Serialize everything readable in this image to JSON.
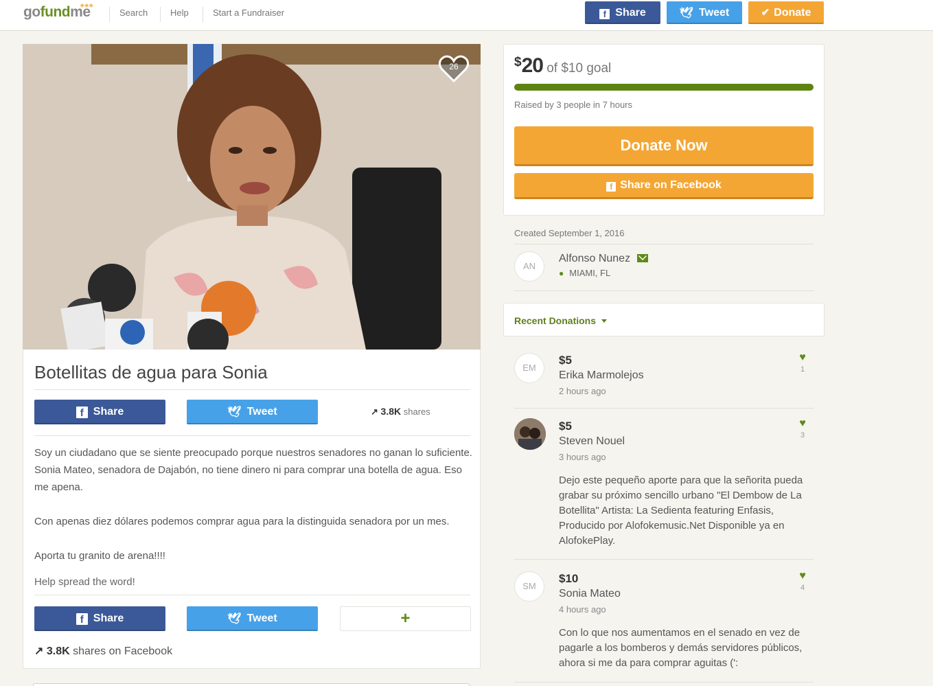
{
  "header": {
    "logo": {
      "go": "go",
      "fund": "fund",
      "me": "me"
    },
    "nav": [
      "Search",
      "Help",
      "Start a Fundraiser"
    ],
    "share_label": "Share",
    "tweet_label": "Tweet",
    "donate_label": "Donate",
    "colors": {
      "share": "#3b5998",
      "tweet": "#46a1e8",
      "donate": "#f4a634"
    }
  },
  "campaign": {
    "heart_count": "26",
    "title": "Botellitas de agua para Sonia",
    "share_label": "Share",
    "tweet_label": "Tweet",
    "shares_count": "3.8K",
    "shares_word": "shares",
    "story": [
      "Soy un ciudadano que se siente preocupado porque nuestros senadores no ganan lo suficiente.  Sonia Mateo, senadora de Dajabón, no tiene dinero ni para comprar una botella de agua.  Eso me apena.",
      "Con apenas diez dólares podemos comprar agua para la distinguida senadora por un mes.",
      "Aporta tu granito de arena!!!!"
    ],
    "help_spread": "Help spread the word!",
    "plus_label": "+",
    "shares_fb_count": "3.8K",
    "shares_fb_text": "shares on Facebook"
  },
  "goal": {
    "dollar": "$",
    "raised": "20",
    "goal_text": "of $10 goal",
    "progress_fraction": 1.0,
    "raised_by": "Raised by 3 people in 7 hours",
    "donate_now": "Donate Now",
    "share_facebook": "Share on Facebook",
    "accent": "#f4a634",
    "bar_color": "#5e8313"
  },
  "organizer": {
    "created": "Created September 1, 2016",
    "initials": "AN",
    "name": "Alfonso Nunez",
    "location": "MIAMI, FL"
  },
  "donations": {
    "title": "Recent Donations",
    "items": [
      {
        "initials": "EM",
        "amount": "$5",
        "name": "Erika Marmolejos",
        "time": "2 hours ago",
        "likes": "1",
        "comment": ""
      },
      {
        "initials": "",
        "amount": "$5",
        "name": "Steven Nouel",
        "time": "3 hours ago",
        "likes": "3",
        "comment": "Dejo este pequeño aporte para que la señorita pueda grabar su próximo sencillo urbano \"El Dembow de La Botellita\" Artista: La Sedienta featuring Enfasis, Producido por Alofokemusic.Net Disponible ya en AlofokePlay."
      },
      {
        "initials": "SM",
        "amount": "$10",
        "name": "Sonia Mateo",
        "time": "4 hours ago",
        "likes": "4",
        "comment": "Con lo que nos aumentamos en el senado en vez de pagarle a los bomberos y demás servidores públicos, ahora si me da para comprar aguitas (':"
      }
    ]
  }
}
